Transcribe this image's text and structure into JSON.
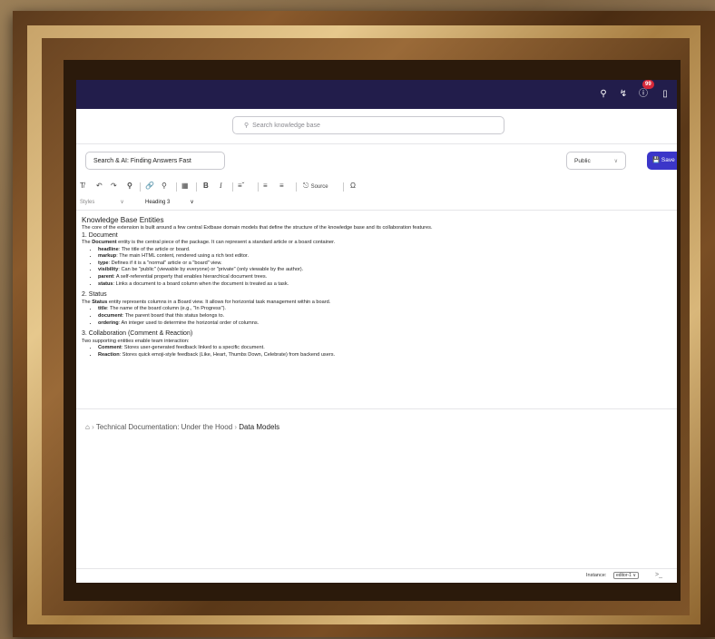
{
  "topbar": {
    "icons": [
      "search-icon",
      "bolt-icon",
      "info-icon",
      "bookmark-icon"
    ],
    "notification_count": "99"
  },
  "search": {
    "placeholder": "Search knowledge base"
  },
  "document": {
    "title": "Search & AI: Finding Answers Fast",
    "visibility": "Public",
    "save_label": "Save"
  },
  "toolbar": {
    "source_label": "Source",
    "styles_label": "Styles",
    "format_value": "Heading 3"
  },
  "content": {
    "heading": "Knowledge Base Entities",
    "intro": "The core of the extension is built around a few central Extbase domain models that define the structure of the knowledge base and its collaboration features.",
    "s1_title": "1. Document",
    "s1_pre": "The ",
    "s1_bold": "Document",
    "s1_post": " entity is the central piece of the package. It can represent a standard article or a board container.",
    "s1_items": [
      {
        "k": "headline",
        "v": ": The title of the article or board."
      },
      {
        "k": "markup",
        "v": ": The main HTML content, rendered using a rich text editor."
      },
      {
        "k": "type",
        "v": ": Defines if it is a \"normal\" article or a \"board\" view."
      },
      {
        "k": "visibility",
        "v": ": Can be \"public\" (viewable by everyone) or \"private\" (only viewable by the author)."
      },
      {
        "k": "parent",
        "v": ": A self-referential property that enables hierarchical document trees."
      },
      {
        "k": "status",
        "v": ": Links a document to a board column when the document is treated as a task."
      }
    ],
    "s2_title": "2. Status",
    "s2_pre": "The ",
    "s2_bold": "Status",
    "s2_post": " entity represents columns in a Board view. It allows for horizontal task management within a board.",
    "s2_items": [
      {
        "k": "title",
        "v": ": The name of the board column (e.g., \"In Progress\")."
      },
      {
        "k": "document",
        "v": ": The parent board that this status belongs to."
      },
      {
        "k": "ordering",
        "v": ": An integer used to determine the horizontal order of columns."
      }
    ],
    "s3_title": "3. Collaboration (Comment & Reaction)",
    "s3_intro": "Two supporting entities enable team interaction:",
    "s3_items": [
      {
        "k": "Comment",
        "v": ": Stores user-generated feedback linked to a specific document."
      },
      {
        "k": "Reaction",
        "v": ": Stores quick emoji-style feedback (Like, Heart, Thumbs Down, Celebrate) from backend users."
      }
    ]
  },
  "breadcrumb": {
    "parent": "Technical Documentation: Under the Hood",
    "current": "Data Models"
  },
  "statusbar": {
    "instance_label": "Instance:",
    "instance_value": "editor-1"
  }
}
